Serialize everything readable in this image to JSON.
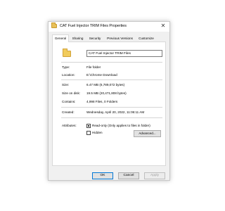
{
  "window": {
    "title": "CAT Fuel Injector TRIM Files Properties",
    "close_glyph": "✕"
  },
  "tabs": [
    {
      "label": "General",
      "active": true
    },
    {
      "label": "Sharing",
      "active": false
    },
    {
      "label": "Security",
      "active": false
    },
    {
      "label": "Previous Versions",
      "active": false
    },
    {
      "label": "Customize",
      "active": false
    }
  ],
  "general": {
    "folder_icon": "folder-icon",
    "name": "CAT Fuel Injector TRIM Files",
    "type_label": "Type:",
    "type_value": "File folder",
    "location_label": "Location:",
    "location_value": "E:\\Chrome Download",
    "size_label": "Size:",
    "size_value": "6.47 MB (6,789,072 bytes)",
    "size_on_disk_label": "Size on disk:",
    "size_on_disk_value": "19.5 MB (20,471,808 bytes)",
    "contains_label": "Contains:",
    "contains_value": "4,998 Files, 0 Folders",
    "created_label": "Created:",
    "created_value": "Wednesday, April 20, 2022, 11:06:11 AM",
    "attributes_label": "Attributes:",
    "readonly_label": "Read-only (Only applies to files in folder)",
    "readonly_checked": true,
    "hidden_label": "Hidden",
    "hidden_checked": false,
    "advanced_label": "Advanced..."
  },
  "footer": {
    "ok_label": "OK",
    "cancel_label": "Cancel",
    "apply_label": "Apply"
  }
}
